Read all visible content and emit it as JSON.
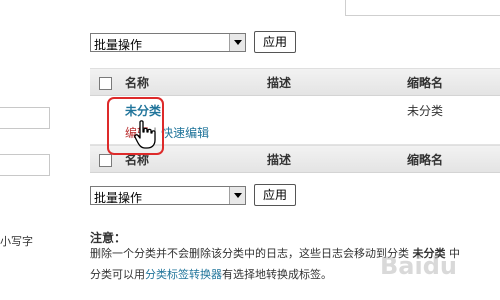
{
  "left": {
    "hint": "小写字"
  },
  "bulk_top": {
    "value": "批量操作",
    "apply": "应用"
  },
  "bulk_bottom": {
    "value": "批量操作",
    "apply": "应用"
  },
  "table": {
    "headers": {
      "name": "名称",
      "description": "描述",
      "slug": "缩略名"
    },
    "rows": [
      {
        "name": "未分类",
        "edit": "编辑",
        "separator": "|",
        "quick_edit": "快速编辑",
        "slug": "未分类"
      }
    ]
  },
  "note": {
    "title": "注意：",
    "line1_a": "删除一个分类并不会删除该分类中的日志，这些日志会移动到分类",
    "line1_b": "未分类",
    "line1_c": "中",
    "line2_a": "分类可以用",
    "line2_link": "分类标签转换器",
    "line2_b": "有选择地转换成标签。"
  },
  "watermark": "Baidu"
}
